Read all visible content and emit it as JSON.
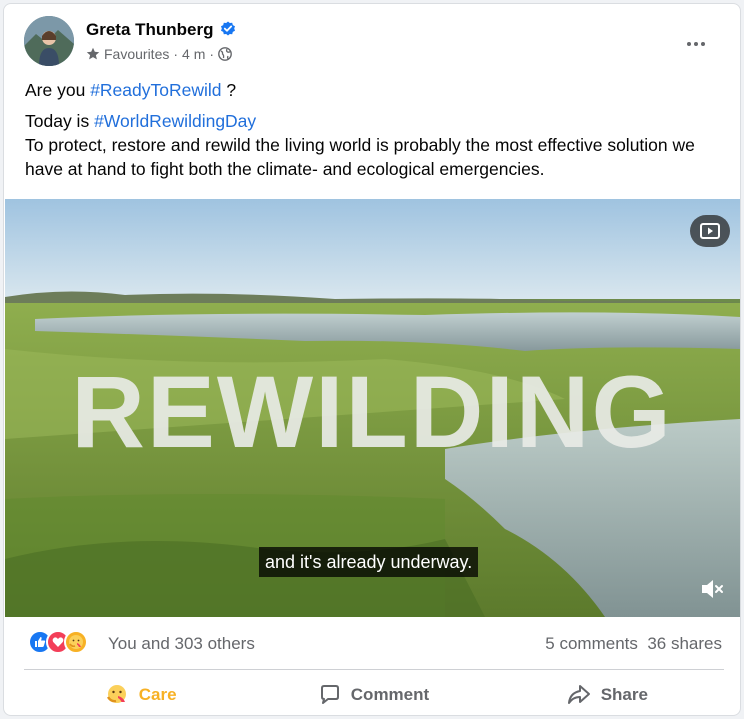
{
  "post": {
    "author": "Greta Thunberg",
    "audience": "Favourites",
    "time": "4 m",
    "separator": "·",
    "line1_pre": "Are you ",
    "line1_tag": "#ReadyToRewild",
    "line1_post": " ?",
    "line2_pre": "Today is ",
    "line2_tag": "#WorldRewildingDay",
    "line3": "To protect, restore and rewild the living world is probably the most effective solution we have at hand to fight both the climate- and ecological emergencies."
  },
  "video": {
    "overlay_title": "REWILDING",
    "subtitle": "and it's already underway."
  },
  "stats": {
    "reactors": "You and 303 others",
    "comments": "5 comments",
    "shares": "36 shares"
  },
  "actions": {
    "care": "Care",
    "comment": "Comment",
    "share": "Share"
  },
  "colors": {
    "link": "#216fdb",
    "care": "#f7b125",
    "like": "#1877f2",
    "love": "#f33e58",
    "muted": "#65676b"
  },
  "icons": [
    "verified-badge-icon",
    "star-icon",
    "globe-icon",
    "more-options-icon",
    "picture-in-picture-icon",
    "mute-icon",
    "like-reaction-icon",
    "love-reaction-icon",
    "care-reaction-icon",
    "comment-icon",
    "share-icon"
  ]
}
